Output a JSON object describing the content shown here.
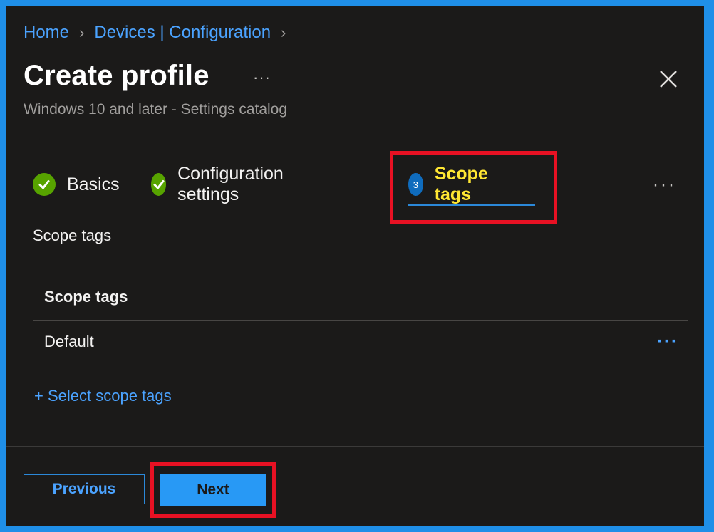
{
  "breadcrumb": {
    "items": [
      {
        "label": "Home"
      },
      {
        "label": "Devices | Configuration"
      }
    ]
  },
  "header": {
    "title": "Create profile",
    "more": "···",
    "subtitle": "Windows 10 and later - Settings catalog"
  },
  "wizard": {
    "steps": [
      {
        "label": "Basics",
        "status": "complete"
      },
      {
        "label": "Configuration settings",
        "status": "complete"
      },
      {
        "label": "Scope tags",
        "number": "3",
        "status": "active"
      }
    ],
    "more": "···"
  },
  "section": {
    "label": "Scope tags"
  },
  "table": {
    "header": "Scope tags",
    "rows": [
      {
        "name": "Default",
        "more": "···"
      }
    ]
  },
  "actions": {
    "select_link": "+ Select scope tags",
    "previous": "Previous",
    "next": "Next"
  },
  "colors": {
    "accent": "#2899f5",
    "link": "#4ba3ff",
    "check": "#57a300",
    "active_step_text": "#ffe733",
    "highlight": "#e81123",
    "background": "#1b1a19"
  }
}
